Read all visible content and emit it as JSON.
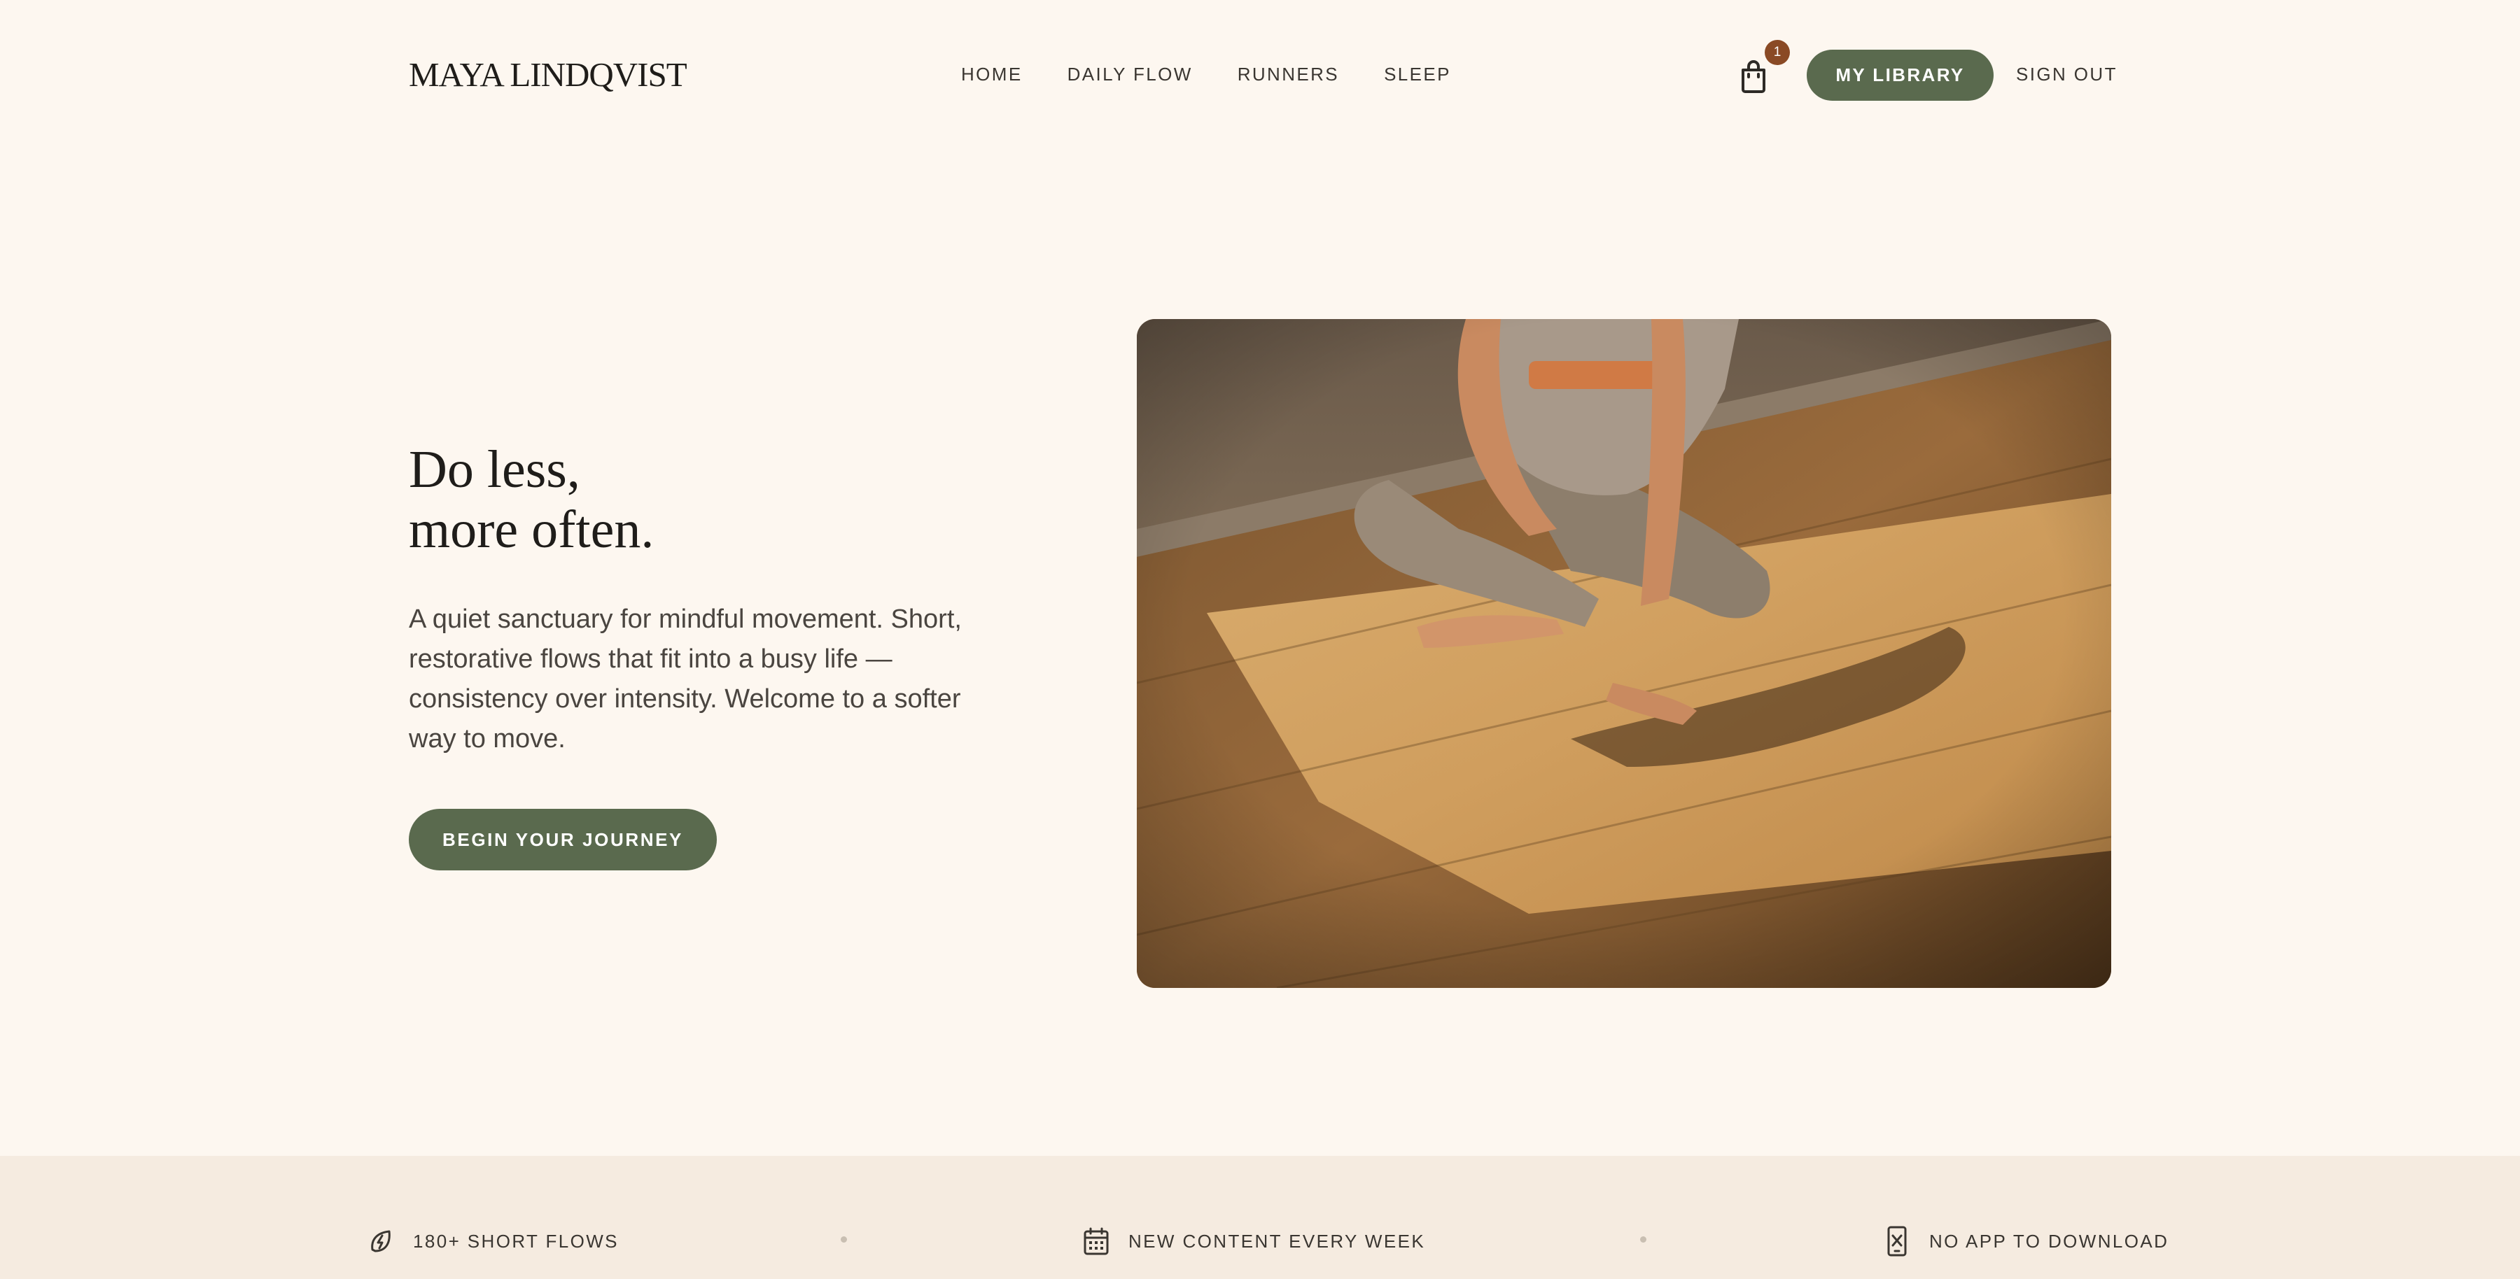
{
  "brand": {
    "name": "MAYA LINDQVIST"
  },
  "nav": {
    "items": [
      "HOME",
      "DAILY FLOW",
      "RUNNERS",
      "SLEEP"
    ]
  },
  "header": {
    "cart_count": "1",
    "library_label": "MY LIBRARY",
    "signout_label": "SIGN OUT"
  },
  "hero": {
    "title_line1": "Do less,",
    "title_line2": "more often.",
    "body": "A quiet sanctuary for mindful movement. Short, restorative flows that fit into a busy life — consistency over intensity. Welcome to a softer way to move.",
    "cta_label": "BEGIN YOUR JOURNEY",
    "image_alt": "woman seated cross-legged on a sunlit wooden floor"
  },
  "features": [
    {
      "icon": "leaf-bolt-icon",
      "label": "180+ SHORT FLOWS"
    },
    {
      "icon": "calendar-icon",
      "label": "NEW CONTENT EVERY WEEK"
    },
    {
      "icon": "no-phone-icon",
      "label": "NO APP TO DOWNLOAD"
    }
  ],
  "colors": {
    "background": "#fdf7f0",
    "strip": "#f5ebe0",
    "accent_green": "#5a6a4e",
    "badge": "#8a4a25"
  }
}
